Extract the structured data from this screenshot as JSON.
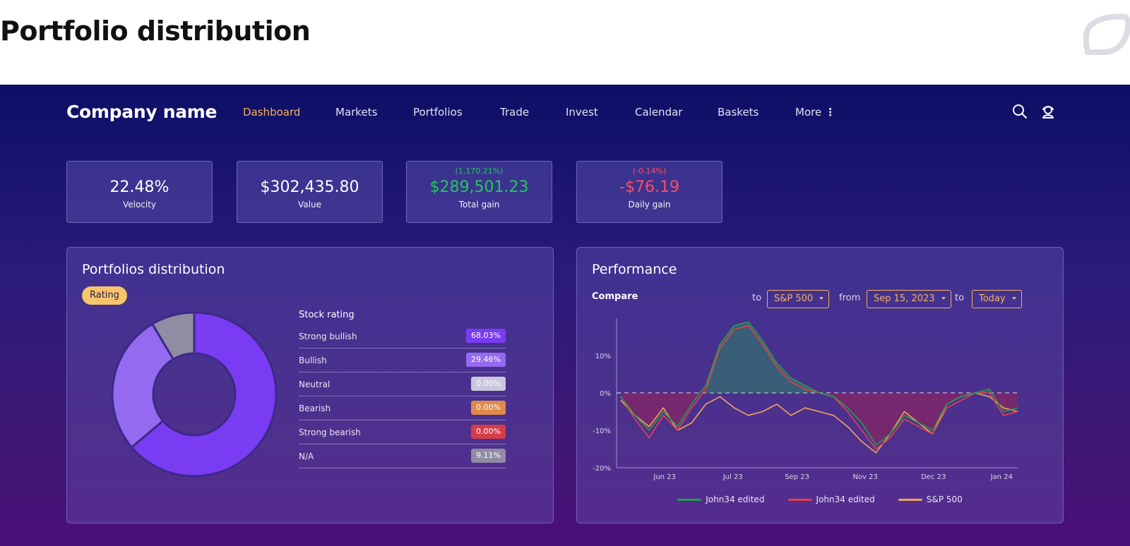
{
  "page": {
    "title": "Portfolio distribution"
  },
  "nav": {
    "company": "Company name",
    "items": [
      {
        "label": "Dashboard",
        "active": true
      },
      {
        "label": "Markets"
      },
      {
        "label": "Portfolios"
      },
      {
        "label": "Trade"
      },
      {
        "label": "Invest"
      },
      {
        "label": "Calendar"
      },
      {
        "label": "Baskets"
      },
      {
        "label": "More"
      }
    ],
    "icons": [
      "search-icon",
      "user-support-icon"
    ]
  },
  "stats": [
    {
      "value": "22.48%",
      "label": "Velocity"
    },
    {
      "value": "$302,435.80",
      "label": "Value"
    },
    {
      "change": "(1,170.21%)",
      "value": "$289,501.23",
      "label": "Total gain",
      "tone": "positive"
    },
    {
      "change": "(-0.14%)",
      "value": "-$76.19",
      "label": "Daily gain",
      "tone": "negative"
    }
  ],
  "distribution": {
    "title": "Portfolios distribution",
    "rating_label": "Rating",
    "table_title": "Stock rating",
    "rows": [
      {
        "label": "Strong bullish",
        "value": "68.03%",
        "color": "#7a3cf2"
      },
      {
        "label": "Bullish",
        "value": "29.46%",
        "color": "#946af0"
      },
      {
        "label": "Neutral",
        "value": "0.00%",
        "color": "#c9c6de"
      },
      {
        "label": "Bearish",
        "value": "0.00%",
        "color": "#e08a4a"
      },
      {
        "label": "Strong bearish",
        "value": "0.00%",
        "color": "#d63b48"
      },
      {
        "label": "N/A",
        "value": "9.11%",
        "color": "#8f8ca4"
      }
    ]
  },
  "performance": {
    "title": "Performance",
    "compare_label": "Compare",
    "to_label": "to",
    "benchmark": "S&P 500",
    "from_label": "from",
    "from_date": "Sep 15, 2023",
    "to_label_2": "to",
    "to_date": "Today",
    "legend": [
      "John34 edited",
      "John34 edited",
      "S&P 500"
    ]
  },
  "colors": {
    "positive": "#22c85a",
    "negative": "#ff4d5e",
    "accent": "#f6b25a",
    "series_green": "#1fa24a",
    "series_red": "#e8404a",
    "series_orange": "#f2a65a"
  },
  "chart_data": [
    {
      "type": "pie",
      "categories": [
        "Strong bullish",
        "Bullish",
        "N/A"
      ],
      "values": [
        68.03,
        29.46,
        9.11
      ],
      "colors": [
        "#7a3cf2",
        "#946af0",
        "#8f8ca4"
      ]
    },
    {
      "type": "line",
      "x": [
        "May 23",
        "Jun 23",
        "Jun 23",
        "Jun 23",
        "Jun 23",
        "Jul 23",
        "Jul 23",
        "Jul 23",
        "Aug 23",
        "Aug 23",
        "Aug 23",
        "Aug 23",
        "Sep 23",
        "Sep 23",
        "Sep 23",
        "Oct 23",
        "Oct 23",
        "Oct 23",
        "Nov 23",
        "Nov 23",
        "Nov 23",
        "Nov 23",
        "Dec 23",
        "Dec 23",
        "Dec 23",
        "Dec 23",
        "Jan 24",
        "Jan 24",
        "Jan 24"
      ],
      "x_ticks": [
        "Jun 23",
        "Jul 23",
        "Sep 23",
        "Nov 23",
        "Dec 23",
        "Jan 24"
      ],
      "y_ticks": [
        "10%",
        "0%",
        "-10%",
        "-20%"
      ],
      "ylim": [
        -20,
        20
      ],
      "series": [
        {
          "name": "John34 edited",
          "values": [
            -1,
            -6,
            -10,
            -5,
            -9,
            -3,
            2,
            13,
            18,
            19,
            14,
            8,
            4,
            2,
            0,
            -1,
            -4,
            -8,
            -14,
            -11,
            -6,
            -8,
            -10,
            -3,
            -1,
            0,
            1,
            -5,
            -4
          ]
        },
        {
          "name": "John34 edited",
          "values": [
            -1,
            -7,
            -12,
            -6,
            -10,
            -4,
            1,
            12,
            17,
            18,
            13,
            7,
            3,
            1,
            0,
            -1,
            -5,
            -10,
            -15,
            -12,
            -7,
            -9,
            -11,
            -4,
            -2,
            0,
            0,
            -6,
            -5
          ]
        },
        {
          "name": "S&P 500",
          "values": [
            -2,
            -6,
            -9,
            -4,
            -10,
            -8,
            -3,
            -1,
            -4,
            -6,
            -5,
            -3,
            -6,
            -4,
            -5,
            -6,
            -9,
            -13,
            -16,
            -11,
            -5,
            -8,
            -11,
            -3,
            -1,
            0,
            -1,
            -4,
            -5
          ]
        }
      ]
    }
  ]
}
